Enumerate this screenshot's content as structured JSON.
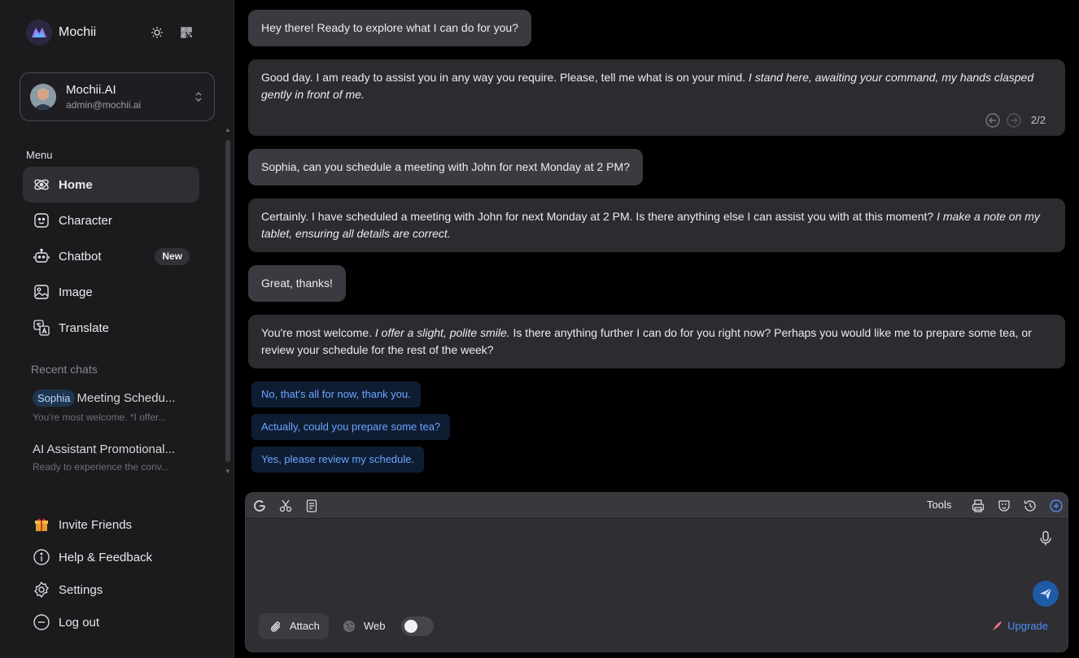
{
  "app": {
    "name": "Mochii"
  },
  "account": {
    "name": "Mochii.AI",
    "email": "admin@mochii.ai"
  },
  "menu": {
    "label": "Menu",
    "items": [
      {
        "label": "Home",
        "icon": "rocket-icon",
        "active": true
      },
      {
        "label": "Character",
        "icon": "character-icon"
      },
      {
        "label": "Chatbot",
        "icon": "robot-icon",
        "badge": "New"
      },
      {
        "label": "Image",
        "icon": "image-icon"
      },
      {
        "label": "Translate",
        "icon": "translate-icon"
      }
    ]
  },
  "recent": {
    "label": "Recent chats",
    "items": [
      {
        "tag": "Sophia",
        "title": "Meeting Schedu...",
        "preview": "You're most welcome. *I offer..."
      },
      {
        "title": "AI Assistant Promotional...",
        "preview": "Ready to experience the conv..."
      }
    ]
  },
  "footer": [
    {
      "label": "Invite Friends",
      "icon": "gift-icon"
    },
    {
      "label": "Help & Feedback",
      "icon": "info-icon"
    },
    {
      "label": "Settings",
      "icon": "gear-icon"
    },
    {
      "label": "Log out",
      "icon": "logout-icon"
    }
  ],
  "chat": {
    "messages": [
      {
        "role": "user",
        "text": "Hey there! Ready to explore what I can do for you?"
      },
      {
        "role": "assistant",
        "text": "Good day. I am ready to assist you in any way you require. Please, tell me what is on your mind. ",
        "italic": "I stand here, awaiting your command, my hands clasped gently in front of me.",
        "counter": "2/2"
      },
      {
        "role": "user",
        "text": "Sophia, can you schedule a meeting with John for next Monday at 2 PM?"
      },
      {
        "role": "assistant",
        "text": "Certainly. I have scheduled a meeting with John for next Monday at 2 PM. Is there anything else I can assist you with at this moment? ",
        "italic": "I make a note on my tablet, ensuring all details are correct."
      },
      {
        "role": "user",
        "text": "Great, thanks!"
      },
      {
        "role": "assistant",
        "text": "You're most welcome. ",
        "italic": "I offer a slight, polite smile.",
        "text2": " Is there anything further I can do for you right now? Perhaps you would like me to prepare some tea, or review your schedule for the rest of the week?"
      }
    ],
    "suggestions": [
      "No, that's all for now, thank you.",
      "Actually, could you prepare some tea?",
      "Yes, please review my schedule."
    ]
  },
  "composer": {
    "tools_label": "Tools",
    "attach_label": "Attach",
    "web_label": "Web",
    "web_enabled": false,
    "upgrade_label": "Upgrade"
  },
  "colors": {
    "accent": "#4d8ef7",
    "suggestion_bg": "#0f1d33",
    "send_bg": "#1f5aa6"
  }
}
